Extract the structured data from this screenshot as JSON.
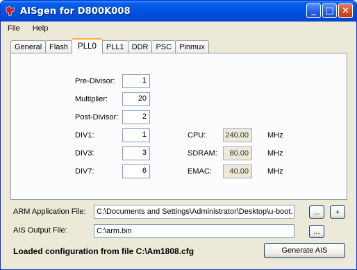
{
  "window": {
    "title": "AISgen for D800K008",
    "min_symbol": "_",
    "max_symbol": "□",
    "close_symbol": "×"
  },
  "menu": {
    "items": [
      "File",
      "Help"
    ]
  },
  "tabs": [
    "General",
    "Flash",
    "PLL0",
    "PLL1",
    "DDR",
    "PSC",
    "Pinmux"
  ],
  "active_tab": "PLL0",
  "pll0": {
    "pre_divisor": {
      "label": "Pre-Divisor:",
      "value": "1"
    },
    "multiplier": {
      "label": "Multiplier:",
      "value": "20"
    },
    "post_divisor": {
      "label": "Post-Divisor:",
      "value": "2"
    },
    "div1": {
      "label": "DIV1:",
      "value": "1"
    },
    "div3": {
      "label": "DIV3:",
      "value": "3"
    },
    "div7": {
      "label": "DIV7:",
      "value": "6"
    },
    "cpu": {
      "label": "CPU:",
      "value": "240.00",
      "unit": "MHz"
    },
    "sdram": {
      "label": "SDRAM:",
      "value": "80.00",
      "unit": "MHz"
    },
    "emac": {
      "label": "EMAC:",
      "value": "40.00",
      "unit": "MHz"
    }
  },
  "files": {
    "arm_label": "ARM Application File:",
    "arm_value": "C:\\Documents and Settings\\Administrator\\Desktop\\u-boot.",
    "ais_label": "AIS Output File:",
    "ais_value": "C:\\arm.bin",
    "browse_label": "...",
    "add_label": "+"
  },
  "status": "Loaded configuration from file C:\\Am1808.cfg",
  "generate_label": "Generate AIS",
  "colors": {
    "titlebar": "#0054e3",
    "active_tab_accent": "#f8b636",
    "logo": "#cc2222"
  }
}
